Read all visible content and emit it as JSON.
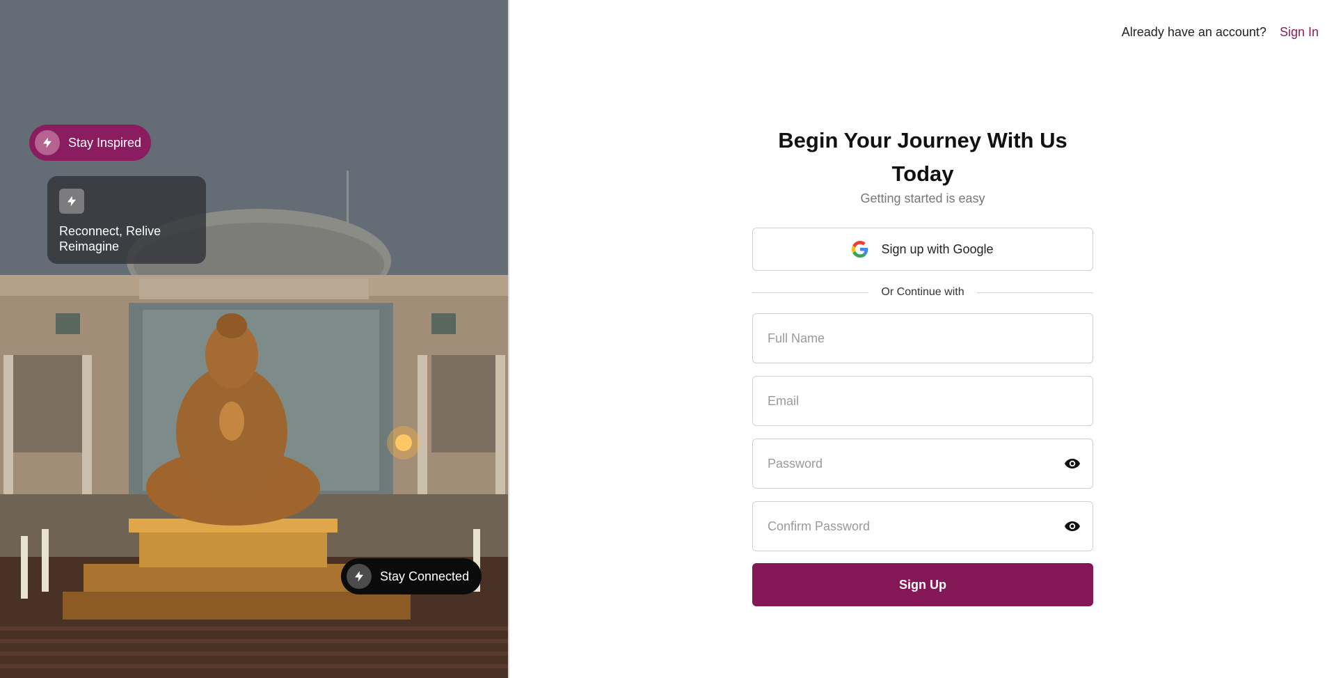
{
  "hero": {
    "image_description_icon": "buddha-statue-photo",
    "pill_top": {
      "label": "Stay Inspired",
      "icon": "lightning-bolt-icon"
    },
    "card": {
      "text": "Reconnect, Relive\nReimagine",
      "icon": "lightning-bolt-icon"
    },
    "pill_bottom": {
      "label": "Stay Connected",
      "icon": "lightning-bolt-icon"
    }
  },
  "header": {
    "prompt": "Already have an account?",
    "signin_label": "Sign In"
  },
  "form": {
    "title": "Begin Your Journey With Us Today",
    "subtitle": "Getting started is easy",
    "google_label": "Sign up with Google",
    "divider_text": "Or Continue with",
    "full_name": {
      "placeholder": "Full Name",
      "value": ""
    },
    "email": {
      "placeholder": "Email",
      "value": ""
    },
    "password": {
      "placeholder": "Password",
      "value": ""
    },
    "confirm_password": {
      "placeholder": "Confirm Password",
      "value": ""
    },
    "submit_label": "Sign Up"
  },
  "colors": {
    "brand": "#841857",
    "pill_inspired_bg": "#8a1d5f",
    "pill_connected_bg": "#0b0b0b",
    "link": "#8a1d5f"
  }
}
